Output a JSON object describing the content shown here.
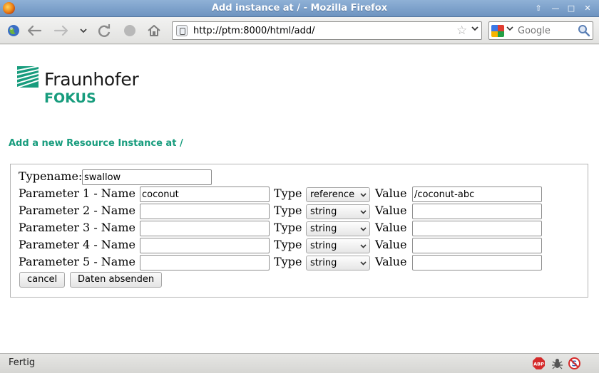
{
  "window": {
    "title": "Add instance at / - Mozilla Firefox"
  },
  "toolbar": {
    "url": "http://ptm:8000/html/add/",
    "search_placeholder": "Google"
  },
  "logo": {
    "name": "Fraunhofer",
    "sub": "FOKUS",
    "color": "#179c7d"
  },
  "page": {
    "heading": "Add a new Resource Instance at /",
    "typename_label": "Typename:",
    "typename_value": "swallow",
    "type_label": "Type",
    "value_label": "Value",
    "params": [
      {
        "label": "Parameter 1 - Name",
        "name": "coconut",
        "type": "reference",
        "value": "/coconut-abc"
      },
      {
        "label": "Parameter 2 - Name",
        "name": "",
        "type": "string",
        "value": ""
      },
      {
        "label": "Parameter 3 - Name",
        "name": "",
        "type": "string",
        "value": ""
      },
      {
        "label": "Parameter 4 - Name",
        "name": "",
        "type": "string",
        "value": ""
      },
      {
        "label": "Parameter 5 - Name",
        "name": "",
        "type": "string",
        "value": ""
      }
    ],
    "cancel_label": "cancel",
    "submit_label": "Daten absenden"
  },
  "statusbar": {
    "text": "Fertig"
  }
}
